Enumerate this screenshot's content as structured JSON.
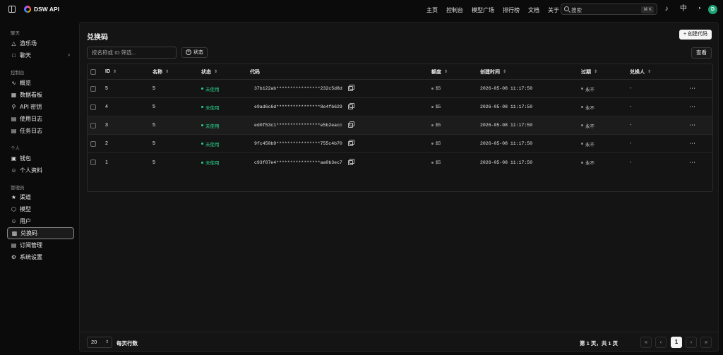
{
  "app": {
    "title": "DSW API",
    "avatar_letter": "D"
  },
  "nav": {
    "items": [
      "主页",
      "控制台",
      "模型广场",
      "排行榜",
      "文档",
      "关于"
    ]
  },
  "search": {
    "placeholder": "搜索",
    "shortcut": "⌘ K"
  },
  "sidebar": {
    "sections": [
      {
        "title": "聊天",
        "items": [
          {
            "label": "游乐场",
            "icon": "flask-icon"
          },
          {
            "label": "聊天",
            "icon": "chat-icon"
          }
        ]
      },
      {
        "title": "控制台",
        "items": [
          {
            "label": "概览",
            "icon": "activity-icon"
          },
          {
            "label": "数据看板",
            "icon": "dashboard-icon"
          },
          {
            "label": "API 密钥",
            "icon": "key-icon"
          },
          {
            "label": "使用日志",
            "icon": "log-icon"
          },
          {
            "label": "任务日志",
            "icon": "task-log-icon"
          }
        ]
      },
      {
        "title": "个人",
        "items": [
          {
            "label": "钱包",
            "icon": "wallet-icon"
          },
          {
            "label": "个人资料",
            "icon": "user-icon"
          }
        ]
      },
      {
        "title": "管理员",
        "items": [
          {
            "label": "渠道",
            "icon": "channel-icon"
          },
          {
            "label": "模型",
            "icon": "cube-icon"
          },
          {
            "label": "用户",
            "icon": "users-icon"
          },
          {
            "label": "兑换码",
            "icon": "ticket-icon"
          },
          {
            "label": "订阅管理",
            "icon": "subscription-icon"
          },
          {
            "label": "系统设置",
            "icon": "gear-icon"
          }
        ]
      }
    ],
    "active": "兑换码"
  },
  "page": {
    "title": "兑换码",
    "create_label": "+ 创建代码",
    "filter_placeholder": "按名称或 ID 筛选...",
    "status_filter_label": "状态",
    "view_label": "查看"
  },
  "table": {
    "headers": {
      "id": "ID",
      "name": "名称",
      "status": "状态",
      "code": "代码",
      "quota": "额度",
      "created": "创建时间",
      "expires": "过期",
      "redeemer": "兑换人"
    },
    "status_color": "#2ad48c",
    "rows": [
      {
        "id": "5",
        "name": "5",
        "status": "未使用",
        "code": "37b122ab****************232c5d8d",
        "quota": "$5",
        "created": "2026-05-08 11:17:50",
        "expires": "永不",
        "redeemer": "-"
      },
      {
        "id": "4",
        "name": "5",
        "status": "未使用",
        "code": "e9ad6c6d****************8e4fb629",
        "quota": "$5",
        "created": "2026-05-08 11:17:50",
        "expires": "永不",
        "redeemer": "-"
      },
      {
        "id": "3",
        "name": "5",
        "status": "未使用",
        "code": "ed0f53c1****************e5b2eacc",
        "quota": "$5",
        "created": "2026-05-08 11:17:50",
        "expires": "永不",
        "redeemer": "-"
      },
      {
        "id": "2",
        "name": "5",
        "status": "未使用",
        "code": "9fc450b9****************755c4b70",
        "quota": "$5",
        "created": "2026-05-08 11:17:50",
        "expires": "永不",
        "redeemer": "-"
      },
      {
        "id": "1",
        "name": "5",
        "status": "未使用",
        "code": "c93f87e4****************aa0b3ec7",
        "quota": "$5",
        "created": "2026-05-08 11:17:50",
        "expires": "永不",
        "redeemer": "-"
      }
    ]
  },
  "footer": {
    "page_size": "20",
    "rows_per_page_label": "每页行数",
    "page_info": "第 1 页，共 1 页",
    "current_page": "1"
  }
}
